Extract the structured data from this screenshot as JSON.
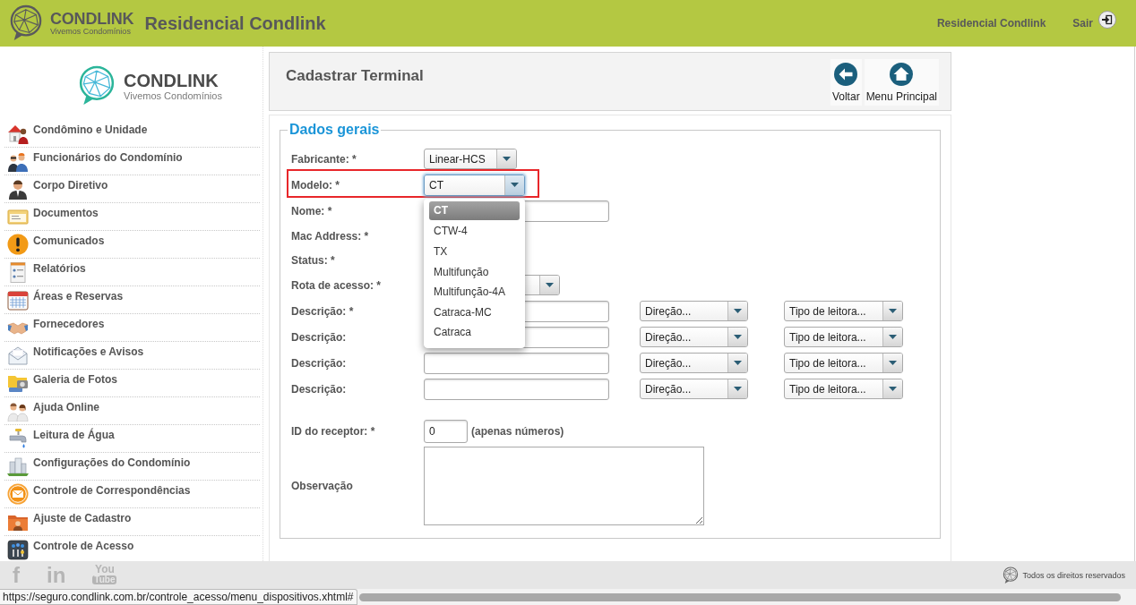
{
  "header": {
    "brand": "CONDLINK",
    "tagline": "Vivemos Condomínios",
    "title": "Residencial Condlink",
    "user": "Residencial Condlink",
    "logout": "Sair"
  },
  "sidebar": {
    "brand": "CONDLINK",
    "tagline": "Vivemos Condomínios",
    "items": [
      {
        "label": "Condômino e Unidade"
      },
      {
        "label": "Funcionários do Condomínio"
      },
      {
        "label": "Corpo Diretivo"
      },
      {
        "label": "Documentos"
      },
      {
        "label": "Comunicados"
      },
      {
        "label": "Relatórios"
      },
      {
        "label": "Áreas e Reservas"
      },
      {
        "label": "Fornecedores"
      },
      {
        "label": "Notificações e Avisos"
      },
      {
        "label": "Galeria de Fotos"
      },
      {
        "label": "Ajuda Online"
      },
      {
        "label": "Leitura de Água"
      },
      {
        "label": "Configurações do Condomínio"
      },
      {
        "label": "Controle de Correspondências"
      },
      {
        "label": "Ajuste de Cadastro"
      },
      {
        "label": "Controle de Acesso"
      }
    ]
  },
  "page_header": {
    "title": "Cadastrar Terminal",
    "actions": [
      {
        "label": "Voltar"
      },
      {
        "label": "Menu Principal"
      }
    ]
  },
  "form": {
    "legend": "Dados gerais",
    "rows": [
      {
        "kind": "select",
        "label": "Fabricante: *",
        "value": "Linear-HCS",
        "highlighted": false,
        "expanded": false
      },
      {
        "kind": "select",
        "label": "Modelo: *",
        "value": "CT",
        "highlighted": true,
        "expanded": true,
        "options": [
          {
            "label": "CT",
            "selected": true
          },
          {
            "label": "CTW-4",
            "selected": false
          },
          {
            "label": "TX",
            "selected": false
          },
          {
            "label": "Multifunção",
            "selected": false
          },
          {
            "label": "Multifunção-4A",
            "selected": false
          },
          {
            "label": "Catraca-MC",
            "selected": false
          },
          {
            "label": "Catraca",
            "selected": false
          }
        ]
      },
      {
        "kind": "text",
        "label": "Nome: *",
        "highlighted": false
      },
      {
        "kind": "label",
        "label": "Mac Address: *",
        "highlighted": false
      },
      {
        "kind": "label",
        "label": "Status: *",
        "highlighted": false
      },
      {
        "kind": "select",
        "label": "Rota de acesso: *",
        "highlighted": false,
        "expanded": false
      },
      {
        "kind": "reader",
        "label": "Descrição: *",
        "direction": "Direção...",
        "reader_type": "Tipo de leitora...",
        "highlighted": false
      },
      {
        "kind": "reader",
        "label": "Descrição:",
        "direction": "Direção...",
        "reader_type": "Tipo de leitora...",
        "highlighted": false
      },
      {
        "kind": "reader",
        "label": "Descrição:",
        "direction": "Direção...",
        "reader_type": "Tipo de leitora...",
        "highlighted": false
      },
      {
        "kind": "reader",
        "label": "Descrição:",
        "direction": "Direção...",
        "reader_type": "Tipo de leitora...",
        "highlighted": false
      },
      {
        "kind": "number",
        "label": "ID do receptor: *",
        "value": "0",
        "hint": "(apenas números)",
        "highlighted": false
      },
      {
        "kind": "textarea",
        "label": "Observação",
        "highlighted": false
      }
    ]
  },
  "footer": {
    "social": [
      {
        "kind": "letter",
        "text": "f"
      },
      {
        "kind": "letter",
        "text": "in"
      },
      {
        "kind": "logo",
        "text": "You",
        "badge": "Tube"
      }
    ],
    "copyright": "Todos os direitos reservados"
  },
  "status_bar": {
    "url": "https://seguro.condlink.com.br/controle_acesso/menu_dispositivos.xhtml#"
  }
}
